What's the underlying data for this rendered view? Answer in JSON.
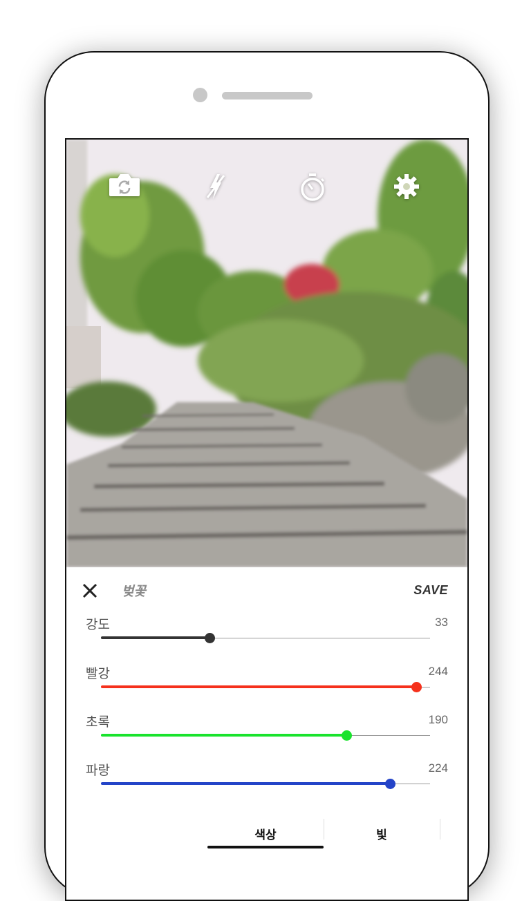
{
  "toolbar": {
    "icons": [
      "switch-camera-icon",
      "flash-off-icon",
      "timer-icon",
      "settings-icon"
    ]
  },
  "editor": {
    "filter_name": "벚꽃",
    "save_label": "SAVE"
  },
  "sliders": [
    {
      "label": "강도",
      "value": "33",
      "fraction": 0.33,
      "color": "#333333"
    },
    {
      "label": "빨강",
      "value": "244",
      "fraction": 0.957,
      "color": "#f5311c"
    },
    {
      "label": "초록",
      "value": "190",
      "fraction": 0.745,
      "color": "#19e32d"
    },
    {
      "label": "파랑",
      "value": "224",
      "fraction": 0.878,
      "color": "#2444c8"
    }
  ],
  "tabs": [
    {
      "label": "색상",
      "active": true
    },
    {
      "label": "빛",
      "active": false
    }
  ]
}
